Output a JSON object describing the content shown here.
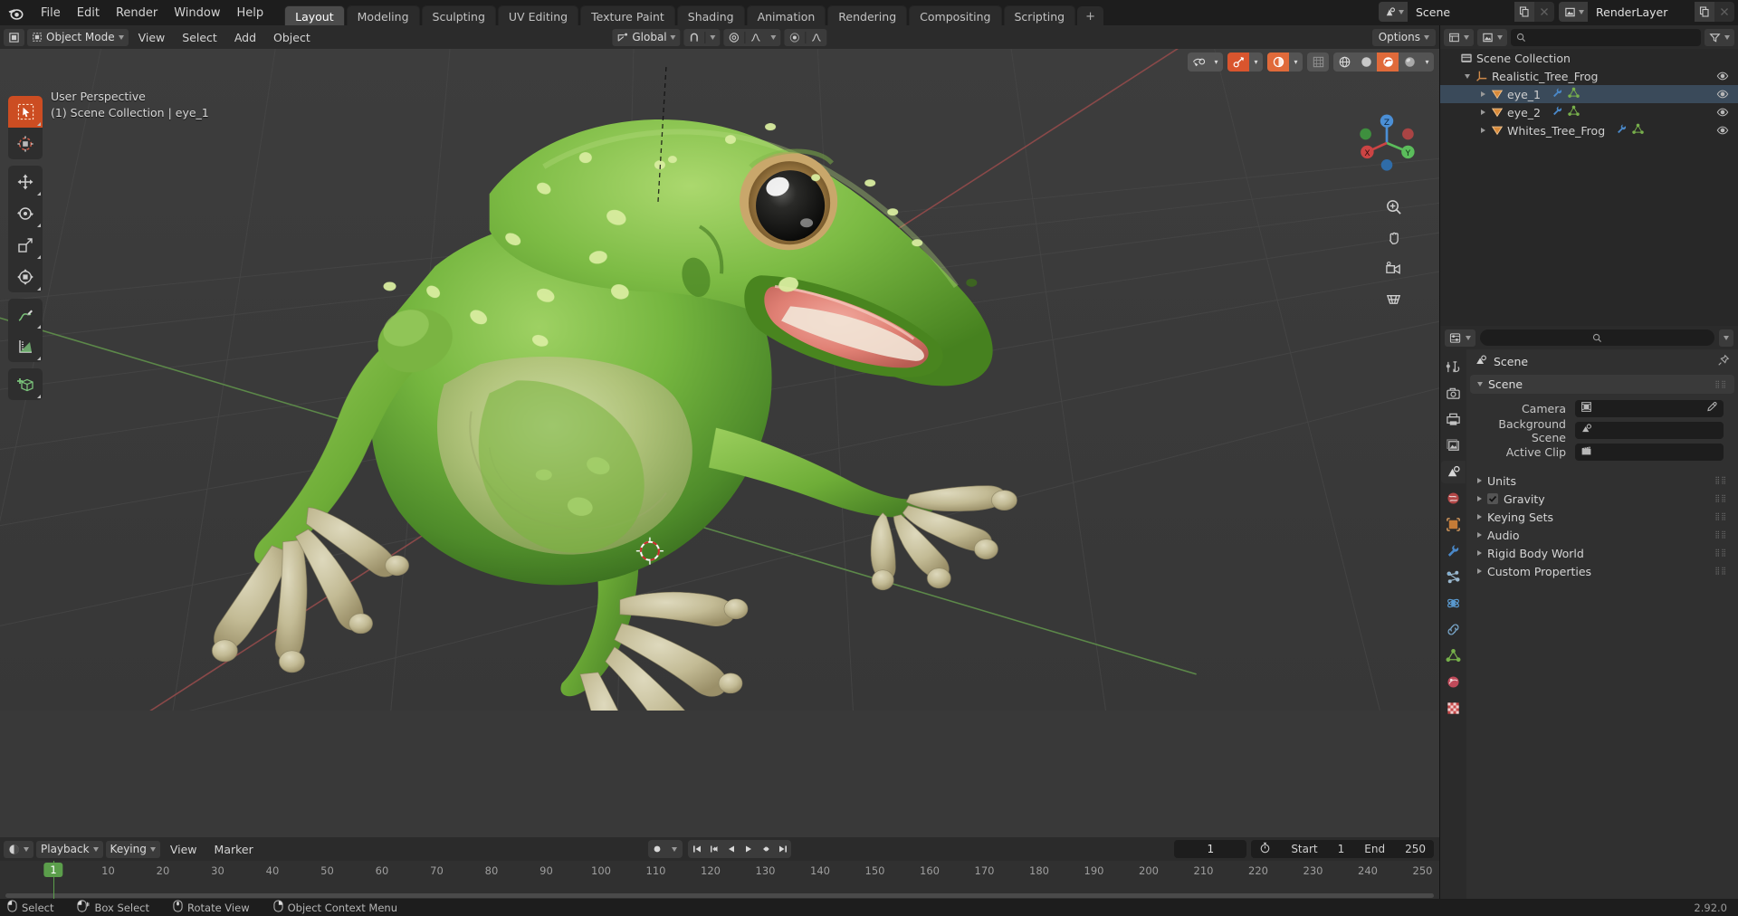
{
  "app": {
    "version": "2.92.0",
    "logo": "blender-logo"
  },
  "topbar": {
    "menus": [
      "File",
      "Edit",
      "Render",
      "Window",
      "Help"
    ],
    "workspaces": [
      {
        "label": "Layout",
        "active": true
      },
      {
        "label": "Modeling",
        "active": false
      },
      {
        "label": "Sculpting",
        "active": false
      },
      {
        "label": "UV Editing",
        "active": false
      },
      {
        "label": "Texture Paint",
        "active": false
      },
      {
        "label": "Shading",
        "active": false
      },
      {
        "label": "Animation",
        "active": false
      },
      {
        "label": "Rendering",
        "active": false
      },
      {
        "label": "Compositing",
        "active": false
      },
      {
        "label": "Scripting",
        "active": false
      }
    ],
    "add_workspace": "+",
    "scene": {
      "icon": "scene-icon",
      "name": "Scene",
      "new_btn": "duplicate-icon",
      "unlink_btn": "x-icon"
    },
    "view_layer": {
      "icon": "view-layer-icon",
      "name": "RenderLayer",
      "new_btn": "duplicate-icon",
      "unlink_btn": "x-icon"
    }
  },
  "viewport": {
    "editor_type_icon": "editor-type-3dview-icon",
    "mode": "Object Mode",
    "menus": [
      "View",
      "Select",
      "Add",
      "Object"
    ],
    "transform_orientation": "Global",
    "snap_icon": "magnet-icon",
    "proportional_icon": "proportional-edit-icon",
    "options_label": "Options",
    "overlay_line1": "User Perspective",
    "overlay_line2": "(1) Scene Collection | eye_1",
    "gizmo_axes": [
      "X",
      "Y",
      "Z"
    ],
    "toolbar_tools": [
      {
        "name": "tweak-select-tool",
        "active": true
      },
      {
        "name": "cursor-tool",
        "active": false
      },
      {
        "name": "move-tool",
        "active": false
      },
      {
        "name": "rotate-tool",
        "active": false
      },
      {
        "name": "scale-tool",
        "active": false
      },
      {
        "name": "transform-tool",
        "active": false
      },
      {
        "name": "annotate-tool",
        "active": false
      },
      {
        "name": "measure-tool",
        "active": false
      },
      {
        "name": "add-cube-tool",
        "active": false
      }
    ],
    "shading_buttons": [
      {
        "name": "show-gizmo-toggle",
        "on": false
      },
      {
        "name": "show-overlays-toggle",
        "on": true
      },
      {
        "name": "xray-toggle",
        "on": true
      },
      {
        "name": "shading-wireframe",
        "on": false
      },
      {
        "name": "shading-solid",
        "on": false
      },
      {
        "name": "shading-material",
        "on": true
      },
      {
        "name": "shading-rendered",
        "on": false
      }
    ],
    "nav_buttons": [
      "zoom-icon",
      "pan-icon",
      "camera-view-icon",
      "toggle-ortho-icon"
    ]
  },
  "timeline": {
    "editor_type_icon": "editor-type-timeline-icon",
    "menus": [
      "Playback",
      "Keying",
      "View",
      "Marker"
    ],
    "playback_label": "Playback",
    "keying_label": "Keying",
    "view_label": "View",
    "marker_label": "Marker",
    "transport": [
      "jump-start-icon",
      "prev-keyframe-icon",
      "play-reverse-icon",
      "play-icon",
      "next-keyframe-icon",
      "jump-end-icon"
    ],
    "record_icon": "auto-keying-icon",
    "current_frame": "1",
    "start_label": "Start",
    "start_value": "1",
    "end_label": "End",
    "end_value": "250",
    "playhead_frame": "1",
    "ticks": [
      "10",
      "20",
      "30",
      "40",
      "50",
      "60",
      "70",
      "80",
      "90",
      "100",
      "110",
      "120",
      "130",
      "140",
      "150",
      "160",
      "170",
      "180",
      "190",
      "200",
      "210",
      "220",
      "230",
      "240",
      "250"
    ]
  },
  "outliner": {
    "editor_type_icon": "editor-type-outliner-icon",
    "display_mode": "View Layer",
    "search_placeholder": "",
    "filter_icon": "filter-icon",
    "rows": [
      {
        "label": "Scene Collection",
        "icon": "collection-icon",
        "depth": 0,
        "disclosure": "none",
        "selected": false,
        "eye": false,
        "mods": []
      },
      {
        "label": "Realistic_Tree_Frog",
        "icon": "empty-axis-icon",
        "depth": 1,
        "disclosure": "open",
        "selected": false,
        "eye": true,
        "mods": []
      },
      {
        "label": "eye_1",
        "icon": "mesh-object-icon",
        "depth": 2,
        "disclosure": "closed",
        "selected": true,
        "eye": true,
        "mods": [
          "modifier-icon",
          "mesh-data-icon"
        ]
      },
      {
        "label": "eye_2",
        "icon": "mesh-object-icon",
        "depth": 2,
        "disclosure": "closed",
        "selected": false,
        "eye": true,
        "mods": [
          "modifier-icon",
          "mesh-data-icon"
        ]
      },
      {
        "label": "Whites_Tree_Frog",
        "icon": "mesh-object-icon",
        "depth": 2,
        "disclosure": "closed",
        "selected": false,
        "eye": true,
        "mods": [
          "modifier-icon",
          "mesh-data-icon"
        ]
      }
    ]
  },
  "properties": {
    "editor_type_icon": "editor-type-properties-icon",
    "search_placeholder": "",
    "tabs": [
      {
        "name": "tool-tab",
        "active": false
      },
      {
        "name": "render-tab",
        "active": false
      },
      {
        "name": "output-tab",
        "active": false
      },
      {
        "name": "view-layer-tab",
        "active": false
      },
      {
        "name": "scene-tab",
        "active": true
      },
      {
        "name": "world-tab",
        "active": false
      },
      {
        "name": "object-tab",
        "active": false
      },
      {
        "name": "modifier-tab",
        "active": false
      },
      {
        "name": "particles-tab",
        "active": false
      },
      {
        "name": "physics-tab",
        "active": false
      },
      {
        "name": "constraint-tab",
        "active": false
      },
      {
        "name": "data-tab",
        "active": false
      },
      {
        "name": "material-tab",
        "active": false
      },
      {
        "name": "texture-tab",
        "active": false
      }
    ],
    "breadcrumb": "Scene",
    "pin_icon": "pin-icon",
    "panel_title": "Scene",
    "fields": [
      {
        "label": "Camera",
        "value": "",
        "icon": "camera-data-icon",
        "eyedropper": true
      },
      {
        "label": "Background Scene",
        "value": "",
        "icon": "scene-icon",
        "eyedropper": false
      },
      {
        "label": "Active Clip",
        "value": "",
        "icon": "movie-clip-icon",
        "eyedropper": false
      }
    ],
    "sections": [
      {
        "label": "Units",
        "checkbox": false,
        "checked": false
      },
      {
        "label": "Gravity",
        "checkbox": true,
        "checked": true
      },
      {
        "label": "Keying Sets",
        "checkbox": false,
        "checked": false
      },
      {
        "label": "Audio",
        "checkbox": false,
        "checked": false
      },
      {
        "label": "Rigid Body World",
        "checkbox": false,
        "checked": false
      },
      {
        "label": "Custom Properties",
        "checkbox": false,
        "checked": false
      }
    ]
  },
  "statusbar": {
    "items": [
      {
        "icon": "mouse-left-icon",
        "label": "Select"
      },
      {
        "icon": "mouse-left-drag-icon",
        "label": "Box Select"
      },
      {
        "icon": "mouse-middle-icon",
        "label": "Rotate View"
      },
      {
        "icon": "mouse-right-icon",
        "label": "Object Context Menu"
      }
    ],
    "version": "2.92.0"
  },
  "colors": {
    "accent_orange": "#e06a3a",
    "select_blue": "#4772b3",
    "green_axis": "#4a8c3a",
    "red_axis": "#8c3a3a",
    "playhead_green": "#5b9e4b",
    "bg_dark": "#1d1d1d",
    "bg_header": "#2b2b2b",
    "bg_panel": "#303030",
    "viewport_bg": "#393939"
  }
}
